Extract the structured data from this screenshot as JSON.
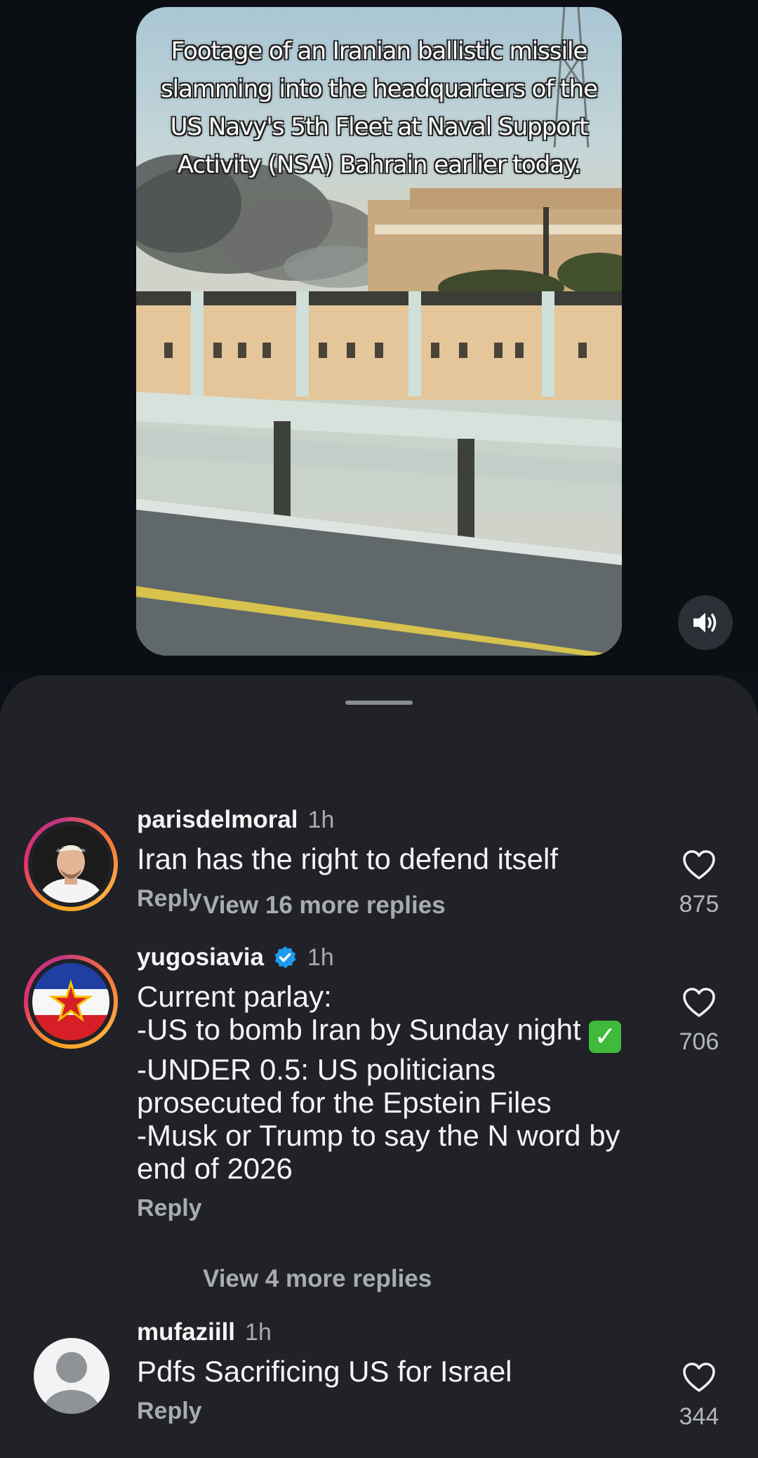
{
  "video": {
    "caption": "Footage of an Iranian ballistic missile slamming into the headquarters of the US Navy's 5th Fleet at Naval Support Activity (NSA) Bahrain earlier today."
  },
  "comments": [
    {
      "username": "parisdelmoral",
      "time": "1h",
      "text": "Iran has the right to defend itself",
      "reply_label": "Reply",
      "likes": "875",
      "view_replies": "View 16 more replies"
    },
    {
      "username": "yugosiavia",
      "time": "1h",
      "verified": true,
      "text_lines": [
        "Current parlay:",
        "-US to bomb Iran by Sunday night",
        "-UNDER 0.5: US politicians prosecuted for the Epstein Files",
        "-Musk or Trump to say the N word by end of 2026"
      ],
      "reply_label": "Reply",
      "likes": "706",
      "view_replies": "View 4 more replies"
    },
    {
      "username": "mufaziill",
      "time": "1h",
      "text": "Pdfs Sacrificing US for Israel",
      "reply_label": "Reply",
      "likes": "344"
    }
  ],
  "icons": {
    "sound": "speaker-on-icon",
    "like": "heart-outline-icon",
    "verified": "verified-badge-icon",
    "check": "check-mark-button-emoji"
  },
  "colors": {
    "background": "#0d1117",
    "sheet": "#202227",
    "verified": "#1d9bf0",
    "muted_text": "#a8abb0"
  }
}
